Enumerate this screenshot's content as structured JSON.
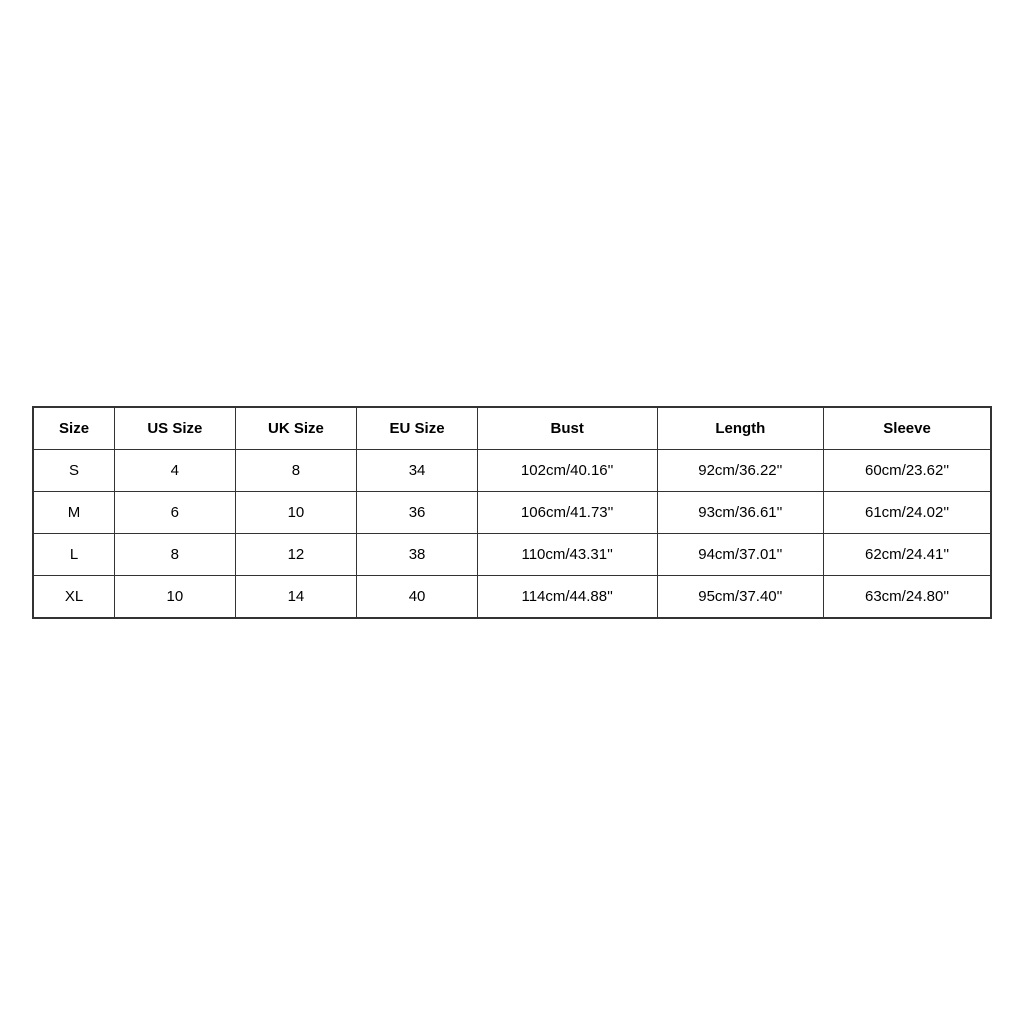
{
  "table": {
    "headers": [
      "Size",
      "US Size",
      "UK Size",
      "EU Size",
      "Bust",
      "Length",
      "Sleeve"
    ],
    "rows": [
      {
        "size": "S",
        "us_size": "4",
        "uk_size": "8",
        "eu_size": "34",
        "bust": "102cm/40.16''",
        "length": "92cm/36.22''",
        "sleeve": "60cm/23.62''"
      },
      {
        "size": "M",
        "us_size": "6",
        "uk_size": "10",
        "eu_size": "36",
        "bust": "106cm/41.73''",
        "length": "93cm/36.61''",
        "sleeve": "61cm/24.02''"
      },
      {
        "size": "L",
        "us_size": "8",
        "uk_size": "12",
        "eu_size": "38",
        "bust": "110cm/43.31''",
        "length": "94cm/37.01''",
        "sleeve": "62cm/24.41''"
      },
      {
        "size": "XL",
        "us_size": "10",
        "uk_size": "14",
        "eu_size": "40",
        "bust": "114cm/44.88''",
        "length": "95cm/37.40''",
        "sleeve": "63cm/24.80''"
      }
    ]
  }
}
